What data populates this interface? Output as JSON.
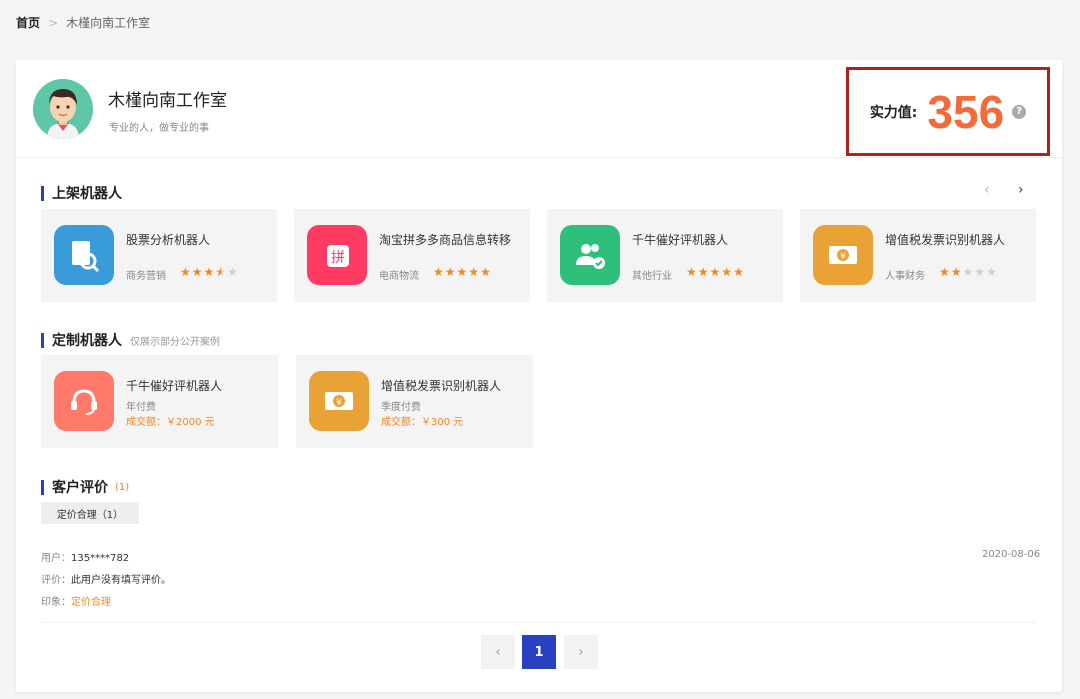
{
  "breadcrumb": {
    "home": "首页",
    "sep": ">",
    "current": "木槿向南工作室"
  },
  "studio": {
    "name": "木槿向南工作室",
    "slogan": "专业的人，做专业的事"
  },
  "power": {
    "label": "实力值:",
    "value": "356",
    "help": "?"
  },
  "listed": {
    "title": "上架机器人",
    "prev": "‹",
    "next": "›",
    "items": [
      {
        "name": "股票分析机器人",
        "category": "商务营销",
        "rating": 3.5,
        "icon": "stock-analysis-icon",
        "color": "#3a9bd9"
      },
      {
        "name": "淘宝拼多多商品信息转移",
        "category": "电商物流",
        "rating": 5,
        "icon": "pinduoduo-icon",
        "color": "#ff3b63"
      },
      {
        "name": "千牛催好评机器人",
        "category": "其他行业",
        "rating": 5,
        "icon": "users-check-icon",
        "color": "#2ec07a"
      },
      {
        "name": "增值税发票识别机器人",
        "category": "人事财务",
        "rating": 2,
        "icon": "invoice-ticket-icon",
        "color": "#e8a235"
      }
    ]
  },
  "custom": {
    "title": "定制机器人",
    "subtitle": "仅展示部分公开案例",
    "items": [
      {
        "name": "千牛催好评机器人",
        "pay": "年付费",
        "deal": "成交额：￥2000 元",
        "icon": "headset-icon",
        "color": "#ff7a6a"
      },
      {
        "name": "增值税发票识别机器人",
        "pay": "季度付费",
        "deal": "成交额：￥300 元",
        "icon": "invoice-ticket-icon",
        "color": "#e8a235"
      }
    ]
  },
  "reviews": {
    "title": "客户评价",
    "count": "(1)",
    "tag": "定价合理（1）",
    "entry": {
      "user_label": "用户：",
      "user": "135****782",
      "comment_label": "评价：",
      "comment": "此用户没有填写评价。",
      "impression_label": "印象：",
      "impression": "定价合理",
      "date": "2020-08-06"
    }
  },
  "pagination": {
    "prev": "‹",
    "page": "1",
    "next": "›"
  }
}
